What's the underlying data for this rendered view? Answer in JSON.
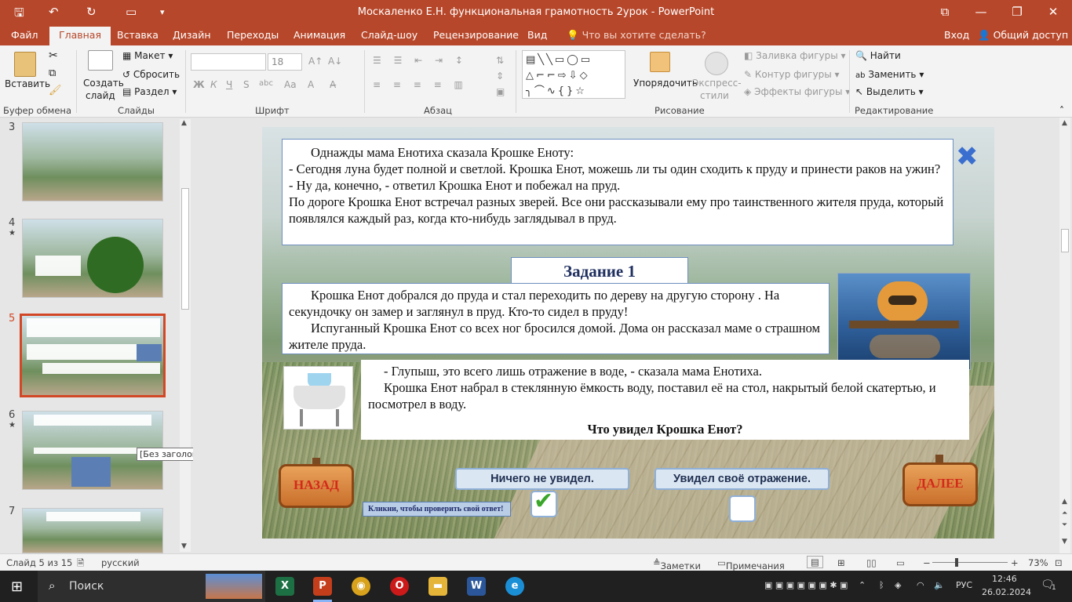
{
  "window": {
    "title": "Москаленко Е.Н. функциональная грамотность 2урок - PowerPoint"
  },
  "tabs": [
    "Файл",
    "Главная",
    "Вставка",
    "Дизайн",
    "Переходы",
    "Анимация",
    "Слайд-шоу",
    "Рецензирование",
    "Вид"
  ],
  "tell_me": "Что вы хотите сделать?",
  "signin": "Вход",
  "share": "Общий доступ",
  "ribbon": {
    "clipboard": {
      "paste": "Вставить",
      "label": "Буфер обмена"
    },
    "slides": {
      "new_slide": "Создать",
      "new_slide2": "слайд",
      "layout": "Макет",
      "reset": "Сбросить",
      "section": "Раздел",
      "label": "Слайды"
    },
    "font": {
      "size": "18",
      "bold": "Ж",
      "italic": "К",
      "underline": "Ч",
      "strike": "S",
      "spacing": "abc",
      "label": "Шрифт"
    },
    "paragraph": {
      "label": "Абзац"
    },
    "drawing": {
      "arrange": "Упорядочить",
      "quick_styles": "Экспресс-",
      "quick_styles2": "стили",
      "fill": "Заливка фигуры",
      "outline": "Контур фигуры",
      "effects": "Эффекты фигуры",
      "label": "Рисование"
    },
    "editing": {
      "find": "Найти",
      "replace": "Заменить",
      "select": "Выделить",
      "label": "Редактирование"
    }
  },
  "thumbnails": [
    {
      "num": "3",
      "star": ""
    },
    {
      "num": "4",
      "star": "★"
    },
    {
      "num": "5",
      "star": ""
    },
    {
      "num": "6",
      "star": "★"
    },
    {
      "num": "7",
      "star": ""
    }
  ],
  "tooltip": "[Без заголовка]",
  "slide": {
    "para1": [
      "Однажды мама Енотиха сказала Крошке Еноту:",
      "- Сегодня луна будет полной и светлой. Крошка Енот, можешь ли ты один сходить к пруду и принести раков на ужин?",
      "- Ну да, конечно, - ответил Крошка Енот и побежал на пруд.",
      "По дороге Крошка Енот встречал разных зверей. Все они рассказывали ему про таинственного жителя пруда, который появлялся каждый раз, когда кто-нибудь заглядывал в пруд."
    ],
    "task_title": "Задание 1",
    "para2": [
      "Крошка Енот добрался до пруда и стал переходить по дереву на другую сторону . На секундочку он замер и заглянул в пруд. Кто-то сидел в пруду!",
      "Испуганный Крошка Енот со всех ног бросился домой. Дома он рассказал маме о страшном жителе пруда."
    ],
    "para3": [
      "- Глупыш, это всего лишь отражение в воде, - сказала мама Енотиха.",
      "Крошка Енот набрал в стеклянную ёмкость воду, поставил её на стол, накрытый белой скатертью, и посмотрел в воду."
    ],
    "question": "Что увидел Крошка Енот?",
    "answer1": "Ничего не увидел.",
    "answer2": "Увидел своё отражение.",
    "checkmark": "✔",
    "hint": "Кликни, чтобы проверить свой ответ!",
    "back": "НАЗАД",
    "next": "ДАЛЕЕ"
  },
  "status": {
    "slide": "Слайд 5 из 15",
    "lang": "русский",
    "notes": "Заметки",
    "comments": "Примечания",
    "zoom": "73%"
  },
  "taskbar": {
    "search": "Поиск",
    "lang": "РУС",
    "time": "12:46",
    "date": "26.02.2024",
    "notif": "1"
  }
}
